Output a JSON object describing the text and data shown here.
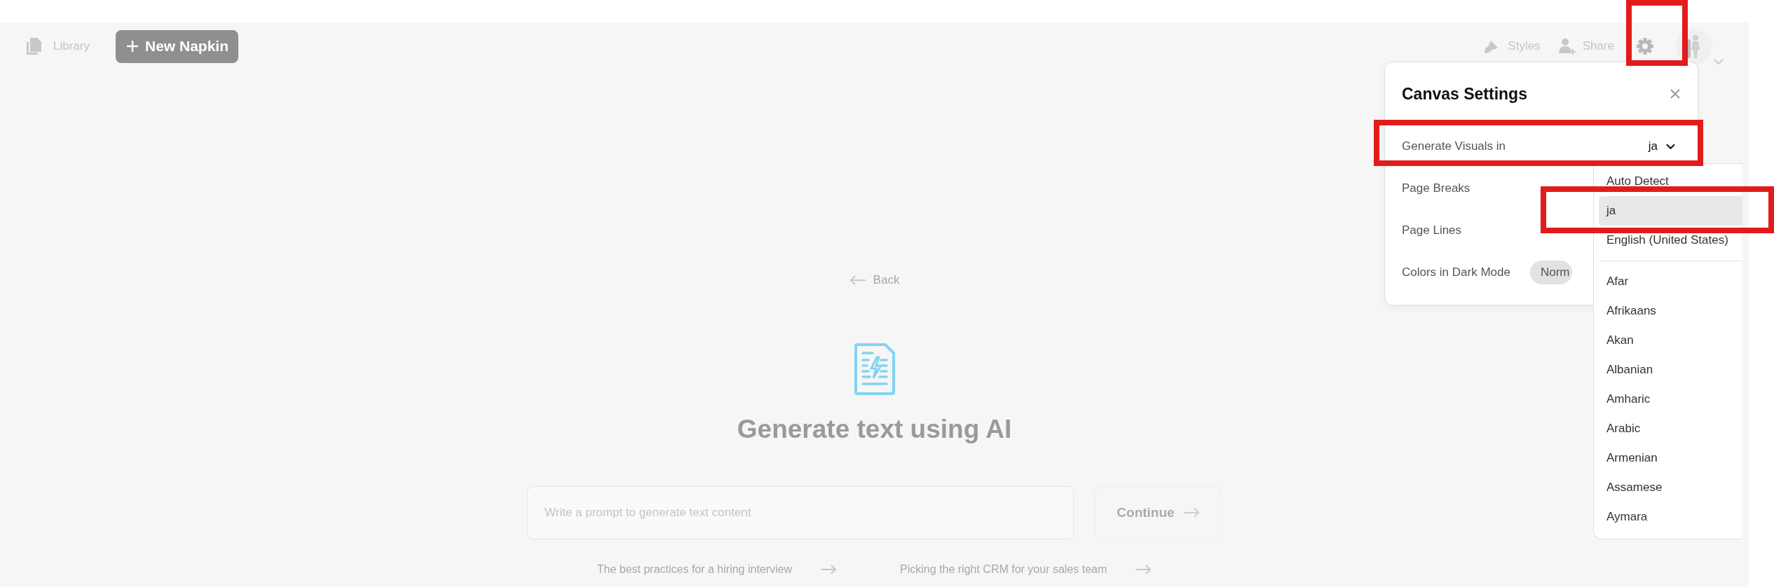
{
  "header": {
    "library": "Library",
    "new_button": "New Napkin",
    "styles": "Styles",
    "share": "Share"
  },
  "settings": {
    "title": "Canvas Settings",
    "rows": [
      {
        "kind": "select",
        "label": "Generate Visuals in",
        "value": "ja"
      },
      {
        "kind": "plain",
        "label": "Page Breaks"
      },
      {
        "kind": "plain",
        "label": "Page Lines"
      },
      {
        "kind": "pill",
        "label": "Colors in Dark Mode",
        "value": "Norm"
      }
    ]
  },
  "dropdown": {
    "pinned": [
      {
        "label": "Auto Detect",
        "selected": false
      },
      {
        "label": "ja",
        "selected": true
      },
      {
        "label": "English (United States)",
        "selected": false
      }
    ],
    "languages": [
      {
        "label": "Afar",
        "selected": false
      },
      {
        "label": "Afrikaans",
        "selected": false
      },
      {
        "label": "Akan",
        "selected": false
      },
      {
        "label": "Albanian",
        "selected": false
      },
      {
        "label": "Amharic",
        "selected": false
      },
      {
        "label": "Arabic",
        "selected": false
      },
      {
        "label": "Armenian",
        "selected": false
      },
      {
        "label": "Assamese",
        "selected": false
      },
      {
        "label": "Aymara",
        "selected": false
      }
    ]
  },
  "prompt": {
    "back": "Back",
    "title": "Generate text using AI",
    "placeholder": "Write a prompt to generate text content",
    "continue": "Continue",
    "suggestions": [
      "The best practices for a hiring interview",
      "Picking the right CRM for your sales team"
    ]
  }
}
